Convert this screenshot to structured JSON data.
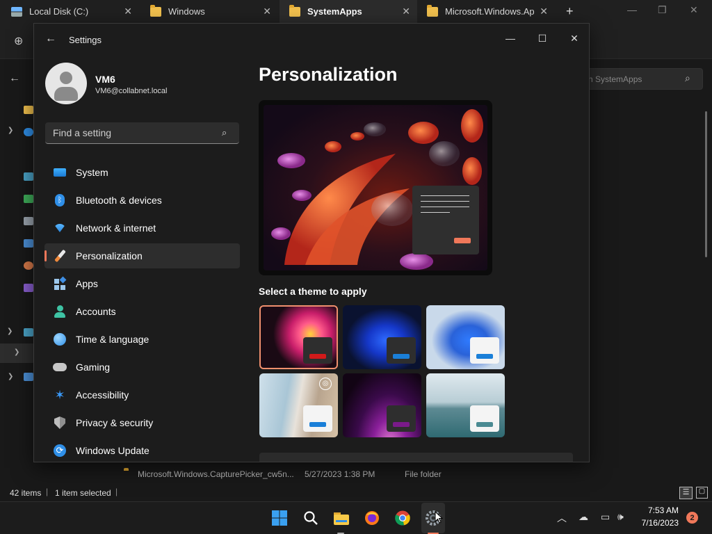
{
  "explorer": {
    "tabs": [
      {
        "label": "Local Disk (C:)"
      },
      {
        "label": "Windows"
      },
      {
        "label": "SystemApps"
      },
      {
        "label": "Microsoft.Windows.Ap"
      }
    ],
    "new_tab_label": "+",
    "search_placeholder": "h SystemApps",
    "file_row": {
      "name": "Microsoft.Windows.CapturePicker_cw5n...",
      "date": "5/27/2023 1:38 PM",
      "type": "File folder"
    },
    "status": {
      "items": "42 items",
      "selected": "1 item selected"
    }
  },
  "settings": {
    "title": "Settings",
    "user": {
      "name": "VM6",
      "email": "VM6@collabnet.local"
    },
    "search_placeholder": "Find a setting",
    "nav": [
      {
        "label": "System",
        "icon": "system-icon"
      },
      {
        "label": "Bluetooth & devices",
        "icon": "bluetooth-icon"
      },
      {
        "label": "Network & internet",
        "icon": "wifi-icon"
      },
      {
        "label": "Personalization",
        "icon": "brush-icon",
        "selected": true
      },
      {
        "label": "Apps",
        "icon": "apps-icon"
      },
      {
        "label": "Accounts",
        "icon": "accounts-icon"
      },
      {
        "label": "Time & language",
        "icon": "globe-icon"
      },
      {
        "label": "Gaming",
        "icon": "gamepad-icon"
      },
      {
        "label": "Accessibility",
        "icon": "accessibility-icon"
      },
      {
        "label": "Privacy & security",
        "icon": "shield-icon"
      },
      {
        "label": "Windows Update",
        "icon": "update-icon"
      }
    ],
    "page_title": "Personalization",
    "theme_heading": "Select a theme to apply",
    "accent_color": "#f0785a"
  },
  "taskbar": {
    "time": "7:53 AM",
    "date": "7/16/2023",
    "notification_count": "2"
  }
}
